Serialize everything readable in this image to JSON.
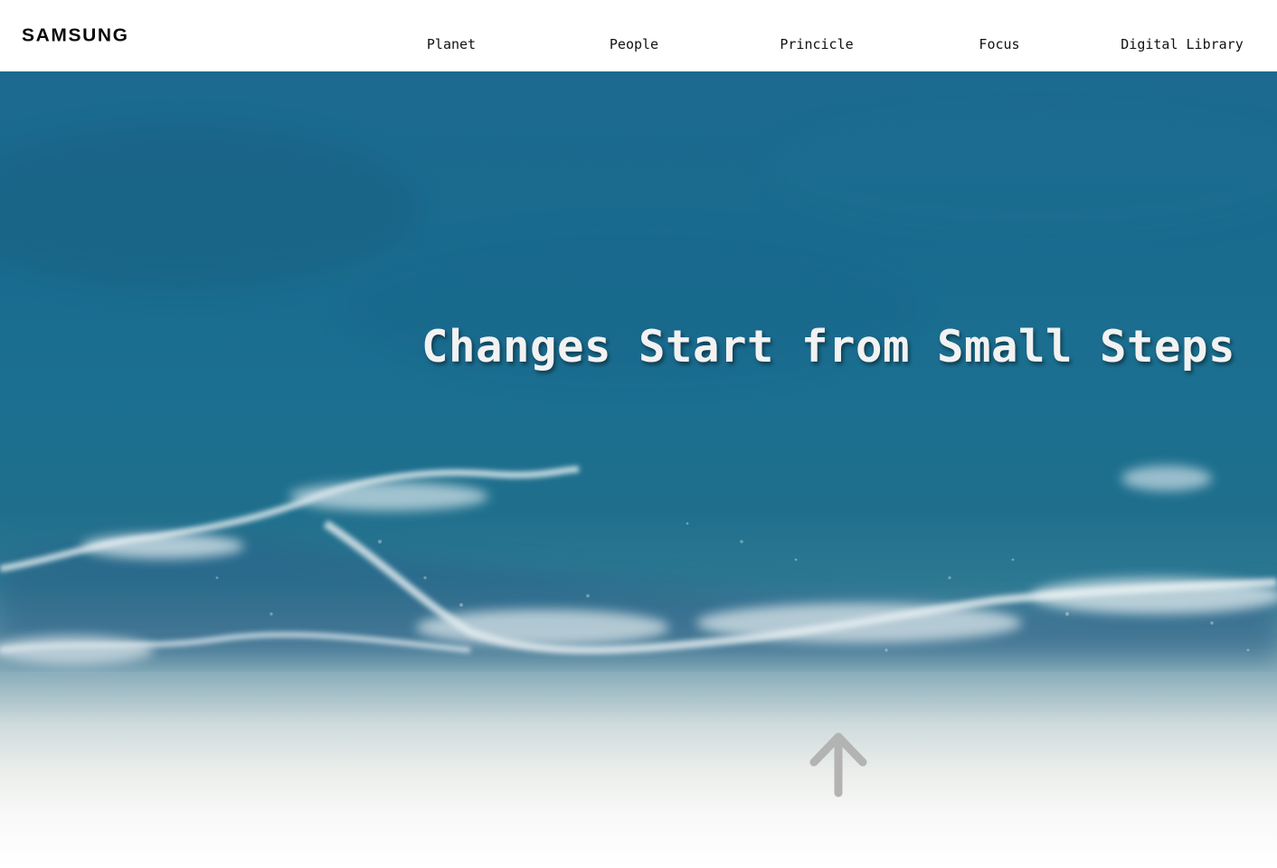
{
  "header": {
    "logo_text": "SAMSUNG",
    "nav": [
      {
        "label": "Planet"
      },
      {
        "label": "People"
      },
      {
        "label": "Princicle"
      },
      {
        "label": "Focus"
      },
      {
        "label": "Digital Library"
      }
    ]
  },
  "hero": {
    "headline": "Changes Start from Small Steps",
    "scroll_icon": "arrow-up-icon"
  },
  "colors": {
    "ocean": "#1c6a8f",
    "foam": "#e8eef0",
    "headline_text": "#f2f2f2",
    "arrow": "#b3b3b3"
  }
}
